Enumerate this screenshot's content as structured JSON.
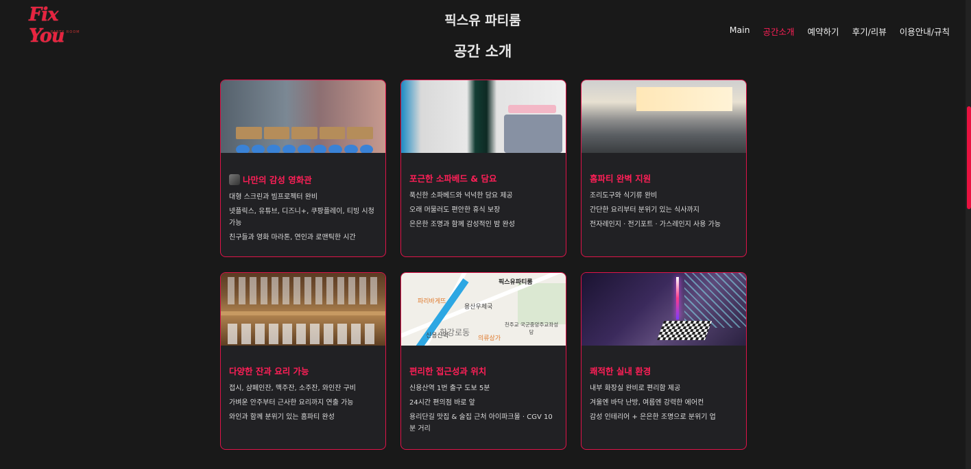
{
  "header": {
    "logo_text": "Fix You",
    "logo_sub": "PARTY ROOM",
    "site_title": "픽스유 파티룸"
  },
  "nav": [
    {
      "label": "Main",
      "active": false
    },
    {
      "label": "공간소개",
      "active": true
    },
    {
      "label": "예약하기",
      "active": false
    },
    {
      "label": "후기/리뷰",
      "active": false
    },
    {
      "label": "이용안내/규칙",
      "active": false
    }
  ],
  "section_title": "공간 소개",
  "colors": {
    "accent": "#ff1f57",
    "background": "#191919",
    "card_bg": "#212124",
    "card_border": "#e0144a"
  },
  "cards": [
    {
      "image": "tv-streaming-screen",
      "icon": "film-camera-icon",
      "title": "나만의 감성 영화관",
      "items": [
        "대형 스크린과 빔프로젝터 완비",
        "넷플릭스, 유튜브, 디즈니+, 쿠팡플레이, 티빙 시청 가능",
        "친구들과 영화 마라톤, 연인과 로맨틱한 시간"
      ]
    },
    {
      "image": "sofa-bed-room",
      "title": "포근한 소파베드 & 담요",
      "items": [
        "푹신한 소파베드와 넉넉한 담요 제공",
        "오래 머물러도 편안한 휴식 보장",
        "은은한 조명과 함께 감성적인 밤 완성"
      ]
    },
    {
      "image": "kitchen",
      "title": "홈파티 완벽 지원",
      "items": [
        "조리도구와 식기류 완비",
        "간단한 요리부터 분위기 있는 식사까지",
        "전자레인지 · 전기포트 · 가스레인지 사용 가능"
      ]
    },
    {
      "image": "glass-shelf",
      "title": "다양한 잔과 요리 가능",
      "items": [
        "접시, 샴페인잔, 맥주잔, 소주잔, 와인잔 구비",
        "가벼운 안주부터 근사한 요리까지 연출 가능",
        "와인과 함께 분위기 있는 홈파티 완성"
      ]
    },
    {
      "image": "location-map",
      "map_labels": {
        "place": "픽스유파티룸",
        "station": "신용산역",
        "area": "한강로동",
        "school": "천주교 국군중앙주교좌성당",
        "post": "용산우체국",
        "shop": "의류상가",
        "cafe": "파리바게뜨"
      },
      "title": "편리한 접근성과 위치",
      "items": [
        "신용산역 1번 출구 도보 5분",
        "24시간 편의점 바로 앞",
        "용리단길 맛집 & 술집 근처 아이파크몰 · CGV 10분 거리"
      ]
    },
    {
      "image": "neon-interior",
      "title": "쾌적한 실내 환경",
      "items": [
        "내부 화장실 완비로 편리함 제공",
        "겨울엔 바닥 난방, 여름엔 강력한 에어컨",
        "감성 인테리어 + 은은한 조명으로 분위기 업"
      ]
    }
  ]
}
